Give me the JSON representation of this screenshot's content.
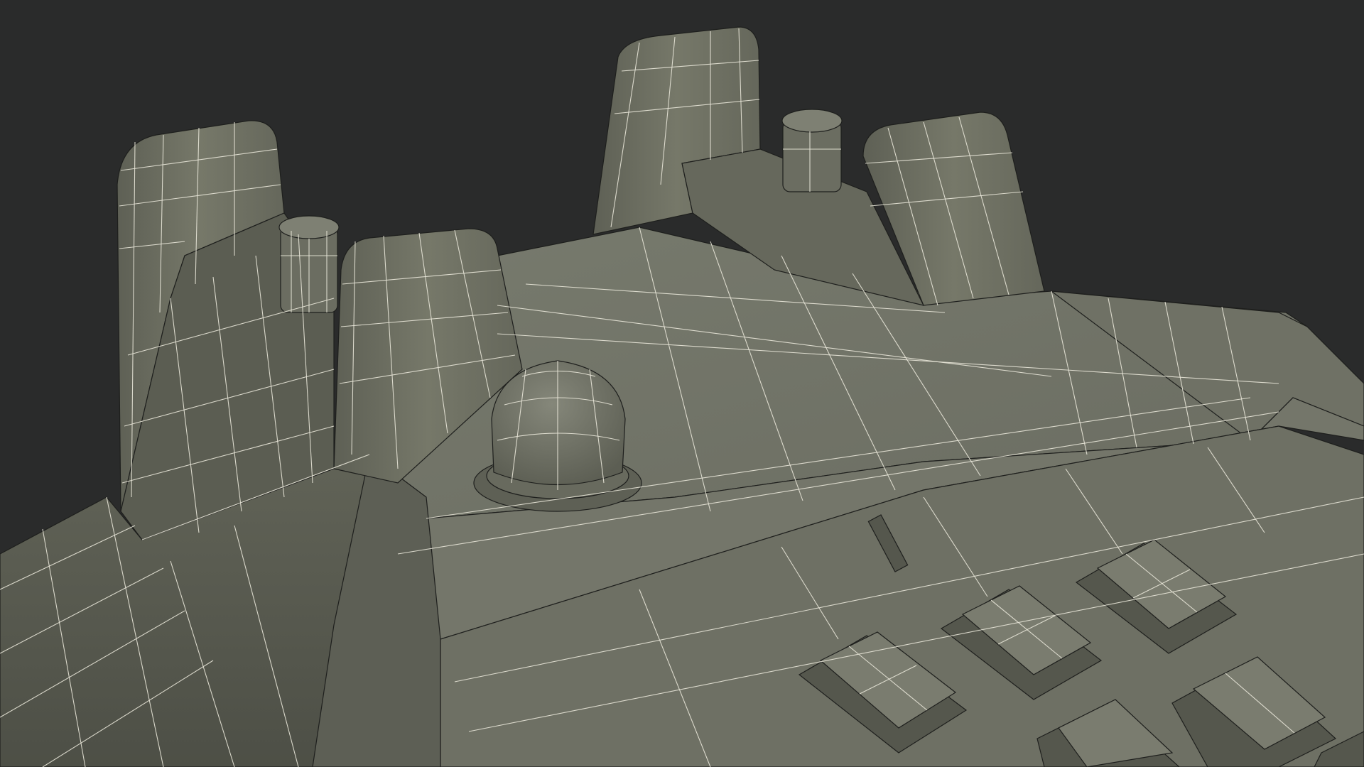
{
  "scene": {
    "subject": "telephone-wireframe-render",
    "colors": {
      "background": "#2a2b2b",
      "body_light": "#7b7d6f",
      "body_mid": "#6d6f63",
      "body_dark": "#55574d",
      "body_shadow": "#45473f",
      "wire": "#e8e6d8"
    },
    "keypad_key_count": 6,
    "cradle_prong_count": 4,
    "hook_switch_count": 2
  }
}
